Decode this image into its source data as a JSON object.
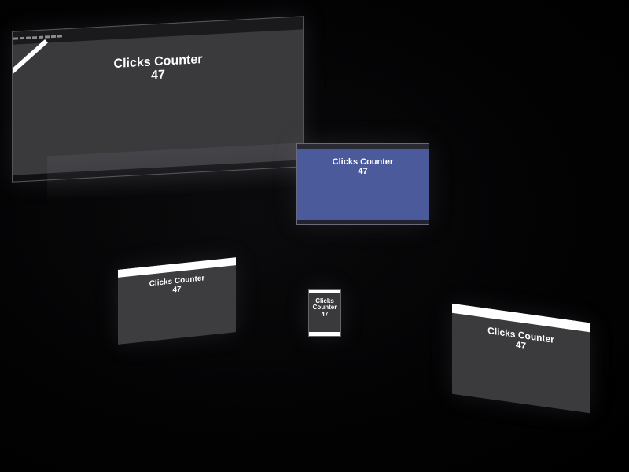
{
  "app": {
    "heading": "Clicks Counter",
    "count": "47"
  },
  "devices": [
    {
      "kind": "desktop-monitor",
      "screen_color": "#3a3a3d"
    },
    {
      "kind": "laptop",
      "screen_color": "#4a5a9a"
    },
    {
      "kind": "tablet-left",
      "screen_color": "#3d3d40"
    },
    {
      "kind": "phone",
      "screen_color": "#3a3a3d"
    },
    {
      "kind": "tablet-right",
      "screen_color": "#3b3b3e"
    }
  ],
  "colors": {
    "background": "#000000",
    "text": "#ffffff",
    "stripe": "#ffffff"
  }
}
